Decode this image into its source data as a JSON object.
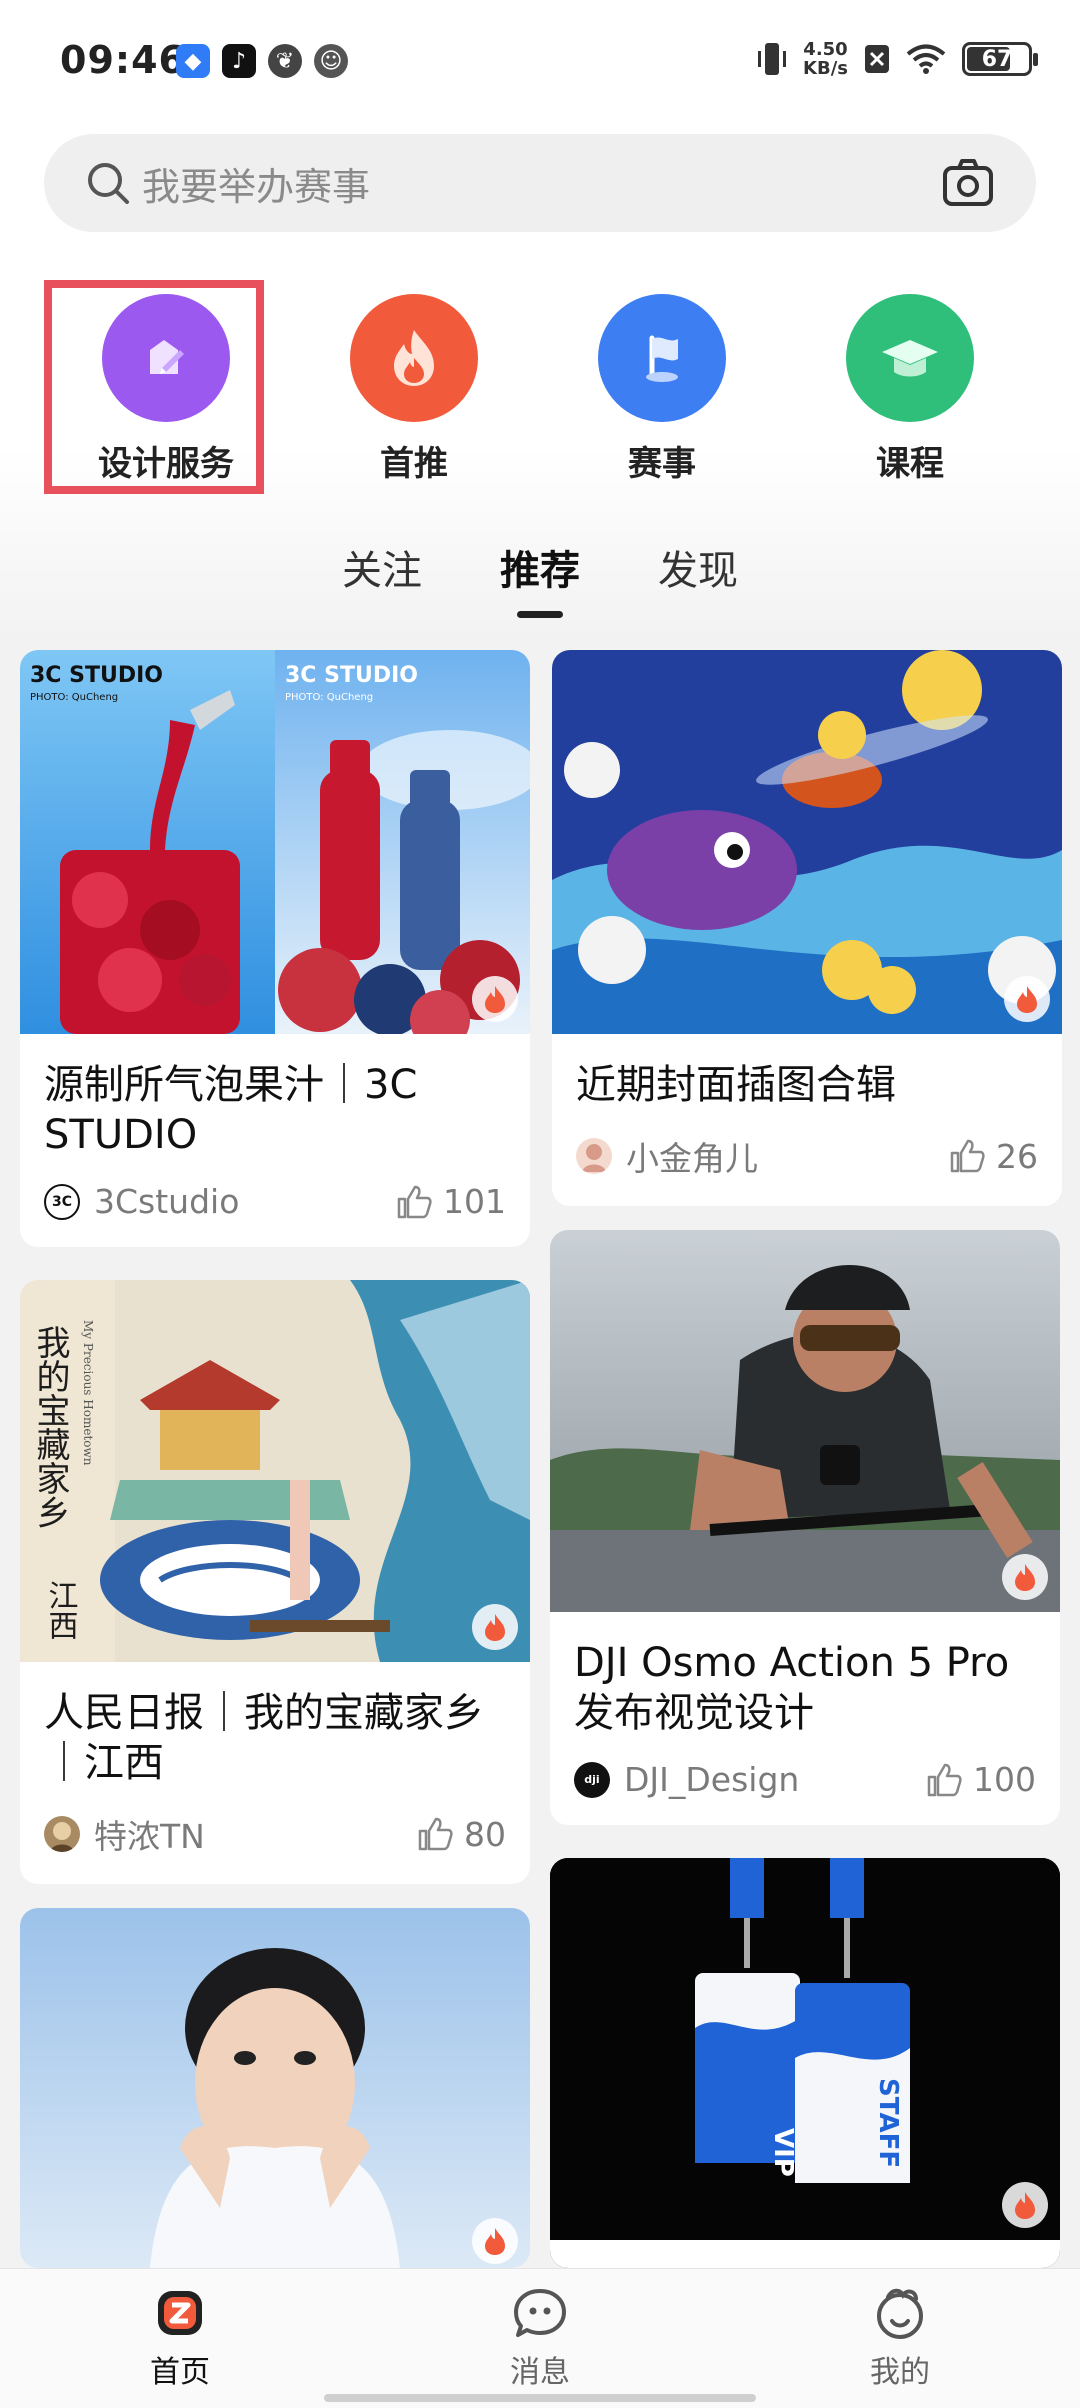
{
  "status_bar": {
    "time": "09:46",
    "net_speed_value": "4.50",
    "net_speed_unit": "KB/s",
    "battery": "67"
  },
  "search": {
    "placeholder": "我要举办赛事"
  },
  "categories": [
    {
      "label": "设计服务",
      "color": "#9b59f0",
      "icon": "pen-icon"
    },
    {
      "label": "首推",
      "color": "#f25a3c",
      "icon": "flame-icon"
    },
    {
      "label": "赛事",
      "color": "#3d7ef2",
      "icon": "flag-icon"
    },
    {
      "label": "课程",
      "color": "#2fbf7b",
      "icon": "graduation-cap-icon"
    }
  ],
  "tabs": [
    {
      "label": "关注",
      "active": false
    },
    {
      "label": "推荐",
      "active": true
    },
    {
      "label": "发现",
      "active": false
    }
  ],
  "cards": [
    {
      "title": "源制所气泡果汁｜3C STUDIO",
      "author": "3Cstudio",
      "likes": "101",
      "image_text_left": "3C STUDIO",
      "image_text_right": "3C STUDIO",
      "photo_credit": "PHOTO: QuCheng"
    },
    {
      "title": "近期封面插图合辑",
      "author": "小金角儿",
      "likes": "26"
    },
    {
      "title": "人民日报｜我的宝藏家乡｜江西",
      "author": "特浓TN",
      "likes": "80",
      "image_text": "我的宝藏家乡",
      "image_text_sub": "江西",
      "image_text_en": "My Precious Hometown"
    },
    {
      "title": "DJI Osmo Action 5 Pro 发布视觉设计",
      "author": "DJI_Design",
      "likes": "100"
    },
    {
      "title": "",
      "author": "",
      "likes": ""
    },
    {
      "title": "",
      "author": "",
      "likes": "",
      "badge_left": "VIP",
      "badge_right": "STAFF"
    }
  ],
  "bottom_nav": [
    {
      "label": "首页",
      "active": true,
      "icon": "home-z-icon"
    },
    {
      "label": "消息",
      "active": false,
      "icon": "message-face-icon"
    },
    {
      "label": "我的",
      "active": false,
      "icon": "profile-face-icon"
    }
  ],
  "colors": {
    "accent_red": "#e8505b",
    "hot_badge": "#f25a3c"
  }
}
